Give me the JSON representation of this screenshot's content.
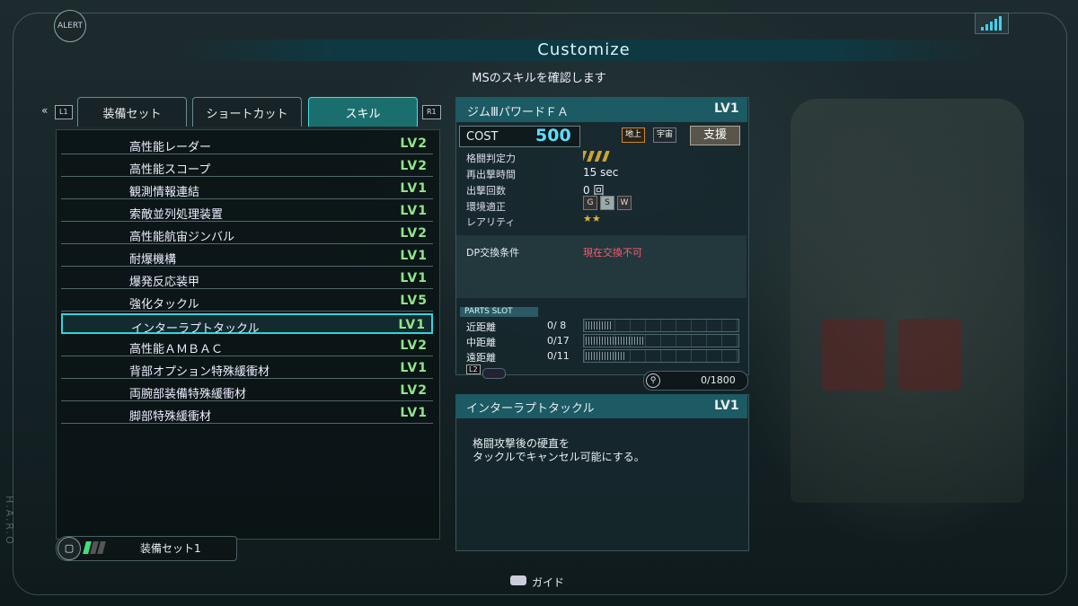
{
  "header": {
    "alert": "ALERT",
    "title": "Customize",
    "subtitle": "MSのスキルを確認します",
    "side_label": "H.A.R.O"
  },
  "tabs": {
    "left_key": "L1",
    "right_key": "R1",
    "items": [
      {
        "label": "装備セット"
      },
      {
        "label": "ショートカット"
      },
      {
        "label": "スキル"
      }
    ]
  },
  "skills": [
    {
      "name": "高性能レーダー",
      "level": "LV2"
    },
    {
      "name": "高性能スコープ",
      "level": "LV2"
    },
    {
      "name": "観測情報連結",
      "level": "LV1"
    },
    {
      "name": "索敵並列処理装置",
      "level": "LV1"
    },
    {
      "name": "高性能航宙ジンバル",
      "level": "LV2"
    },
    {
      "name": "耐爆機構",
      "level": "LV1"
    },
    {
      "name": "爆発反応装甲",
      "level": "LV1"
    },
    {
      "name": "強化タックル",
      "level": "LV5"
    },
    {
      "name": "インターラプトタックル",
      "level": "LV1"
    },
    {
      "name": "高性能ＡＭＢＡＣ",
      "level": "LV2"
    },
    {
      "name": "背部オプション特殊緩衝材",
      "level": "LV1"
    },
    {
      "name": "両腕部装備特殊緩衝材",
      "level": "LV2"
    },
    {
      "name": "脚部特殊緩衝材",
      "level": "LV1"
    }
  ],
  "ms": {
    "name": "ジムⅢパワードＦＡ",
    "level": "LV1",
    "cost_label": "COST",
    "cost": "500",
    "terrain_ground": "地上",
    "terrain_space": "宇宙",
    "role": "支援",
    "stats": [
      {
        "label": "格闘判定力",
        "value": ""
      },
      {
        "label": "再出撃時間",
        "value": "15 sec"
      },
      {
        "label": "出撃回数",
        "value": "0 回"
      },
      {
        "label": "環境適正",
        "value": ""
      },
      {
        "label": "レアリティ",
        "value": ""
      }
    ],
    "melee_rating": 1,
    "env": [
      "G",
      "S",
      "W"
    ],
    "env_active": "S",
    "rarity": "★★",
    "dp_label": "DP交換条件",
    "dp_value": "現在交換不可"
  },
  "parts_slot": {
    "title": "PARTS SLOT",
    "rows": [
      {
        "label": "近距離",
        "value": "0/ 8",
        "fill": 0.16
      },
      {
        "label": "中距離",
        "value": "0/17",
        "fill": 0.36
      },
      {
        "label": "遠距離",
        "value": "0/11",
        "fill": 0.24
      }
    ],
    "l2": "L2",
    "capacity": "0/1800"
  },
  "description": {
    "name": "インターラプトタックル",
    "level": "LV1",
    "line1": "格闘攻撃後の硬直を",
    "line2": "タックルでキャンセル可能にする。"
  },
  "footer": {
    "loadout": "装備セット1",
    "guide": "ガイド"
  },
  "colors": {
    "level_green": "#8fe68a",
    "cost_cyan": "#5fdcff",
    "dp_red": "#ff5a6e",
    "tab_active": "#1a6f6e"
  }
}
